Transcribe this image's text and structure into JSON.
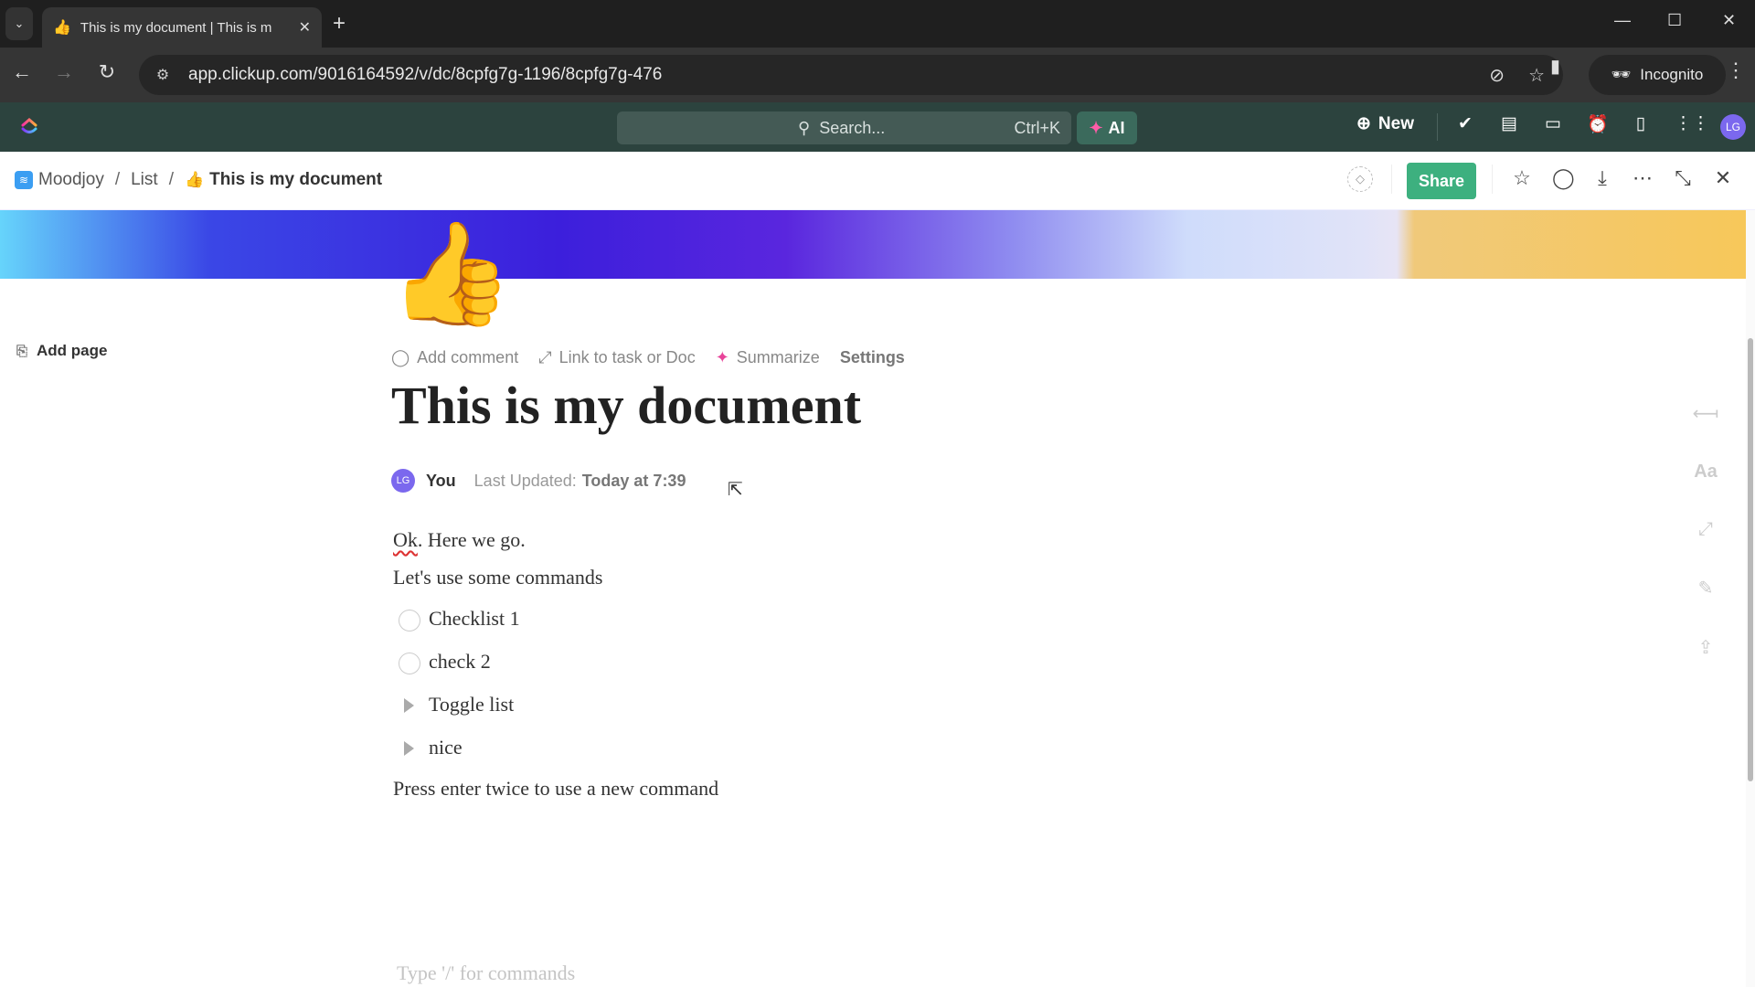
{
  "browser": {
    "tab_title": "This is my document | This is m",
    "tab_favicon": "👍",
    "url": "app.clickup.com/9016164592/v/dc/8cpfg7g-1196/8cpfg7g-476",
    "profile_label": "Incognito"
  },
  "topbar": {
    "search_placeholder": "Search...",
    "search_shortcut": "Ctrl+K",
    "ai_label": "AI",
    "new_label": "New",
    "avatar_initials": "LG"
  },
  "breadcrumb": {
    "space": "Moodjoy",
    "list": "List",
    "doc_emoji": "👍",
    "doc": "This is my document"
  },
  "header_actions": {
    "share_label": "Share"
  },
  "sidebar": {
    "add_page_label": "Add page"
  },
  "document": {
    "emoji": "👍",
    "actions": {
      "add_comment": "Add comment",
      "link": "Link to task or Doc",
      "summarize": "Summarize",
      "settings": "Settings"
    },
    "title": "This is my document",
    "author_initials": "LG",
    "author": "You",
    "last_updated_label": "Last Updated:",
    "last_updated_value": "Today at 7:39",
    "body": {
      "line1_spell": "Ok",
      "line1_rest": ". Here we go.",
      "line2": "Let's use some commands",
      "checklist": [
        {
          "label": "Checklist 1",
          "checked": false
        },
        {
          "label": "check 2",
          "checked": false
        }
      ],
      "toggles": [
        {
          "label": "Toggle list",
          "expanded": false
        },
        {
          "label": "nice",
          "expanded": false
        }
      ],
      "line_last": "Press enter twice to use a new command"
    },
    "placeholder": "Type '/' for commands"
  },
  "right_rail": {
    "icons": [
      "collapse-width-icon",
      "font-size-icon",
      "link-icon",
      "edit-off-icon",
      "export-icon"
    ]
  }
}
